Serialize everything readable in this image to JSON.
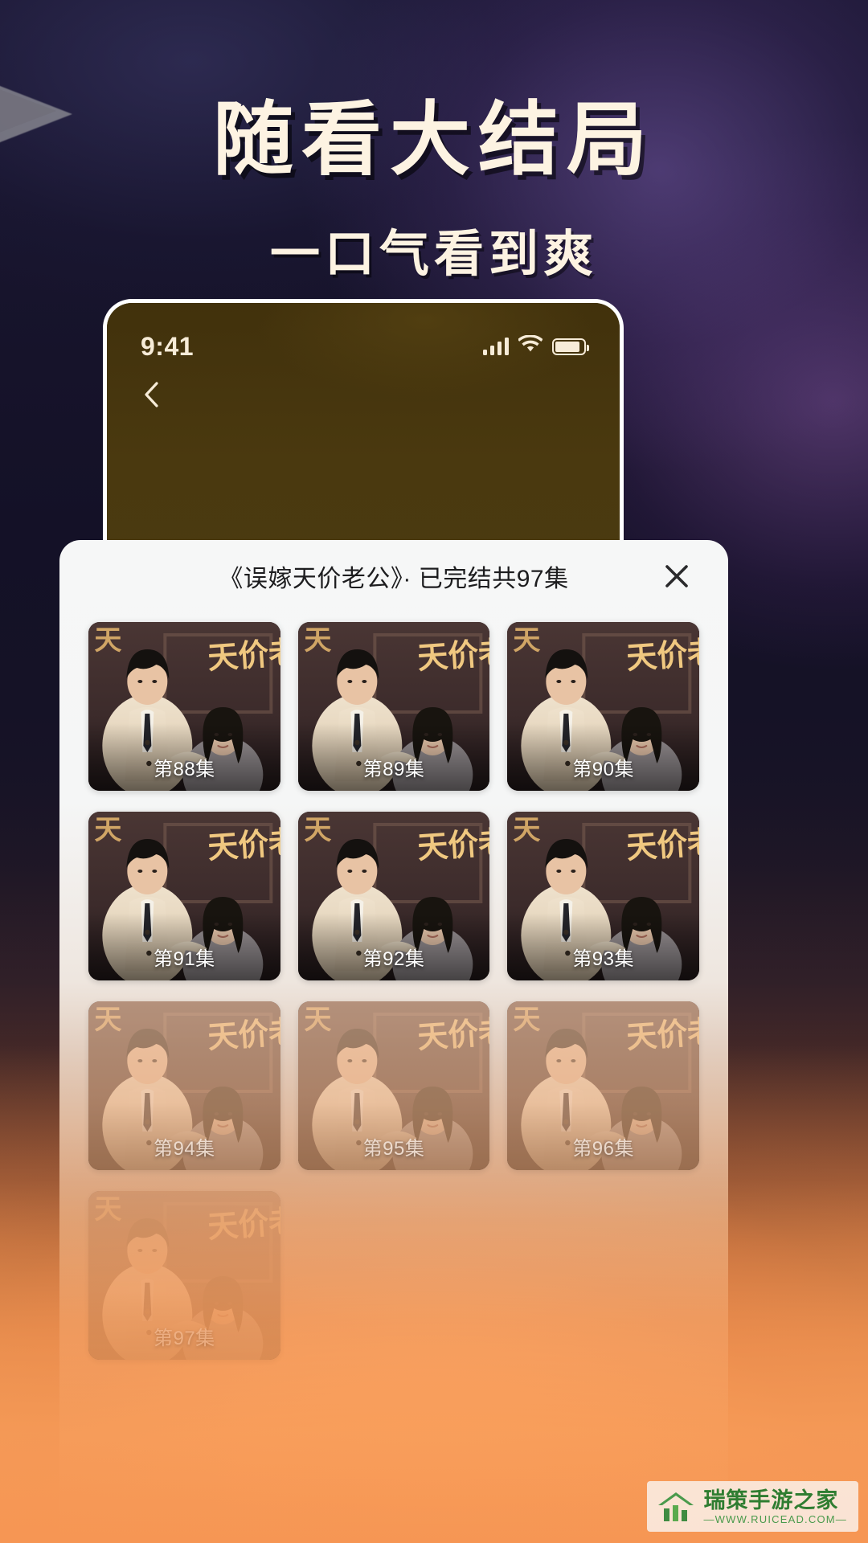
{
  "promo": {
    "headline": "随看大结局",
    "subhead": "一口气看到爽"
  },
  "phone": {
    "status_bar": {
      "time": "9:41",
      "signal_icon": "signal-bars-icon",
      "wifi_icon": "wifi-icon",
      "battery_icon": "battery-icon"
    },
    "nav": {
      "back_icon": "chevron-left-icon"
    }
  },
  "sheet": {
    "title": "《误嫁天价老公》· 已完结共97集",
    "close_icon": "close-icon",
    "episodes": [
      {
        "label": "第88集",
        "fade": "none"
      },
      {
        "label": "第89集",
        "fade": "none"
      },
      {
        "label": "第90集",
        "fade": "none"
      },
      {
        "label": "第91集",
        "fade": "none"
      },
      {
        "label": "第92集",
        "fade": "none"
      },
      {
        "label": "第93集",
        "fade": "none"
      },
      {
        "label": "第94集",
        "fade": "fade1"
      },
      {
        "label": "第95集",
        "fade": "fade1"
      },
      {
        "label": "第96集",
        "fade": "fade1"
      },
      {
        "label": "第97集",
        "fade": "fade2"
      }
    ],
    "poster_text": "天价老公"
  },
  "watermark": {
    "icon": "house-logo-icon",
    "name": "瑞策手游之家",
    "url": "—WWW.RUICEAD.COM—"
  },
  "colors": {
    "headline": "#fdf3e2",
    "sheet_bg": "#f6f7f7",
    "warm_accent": "#f89a54",
    "watermark_green": "#2f7d31"
  }
}
